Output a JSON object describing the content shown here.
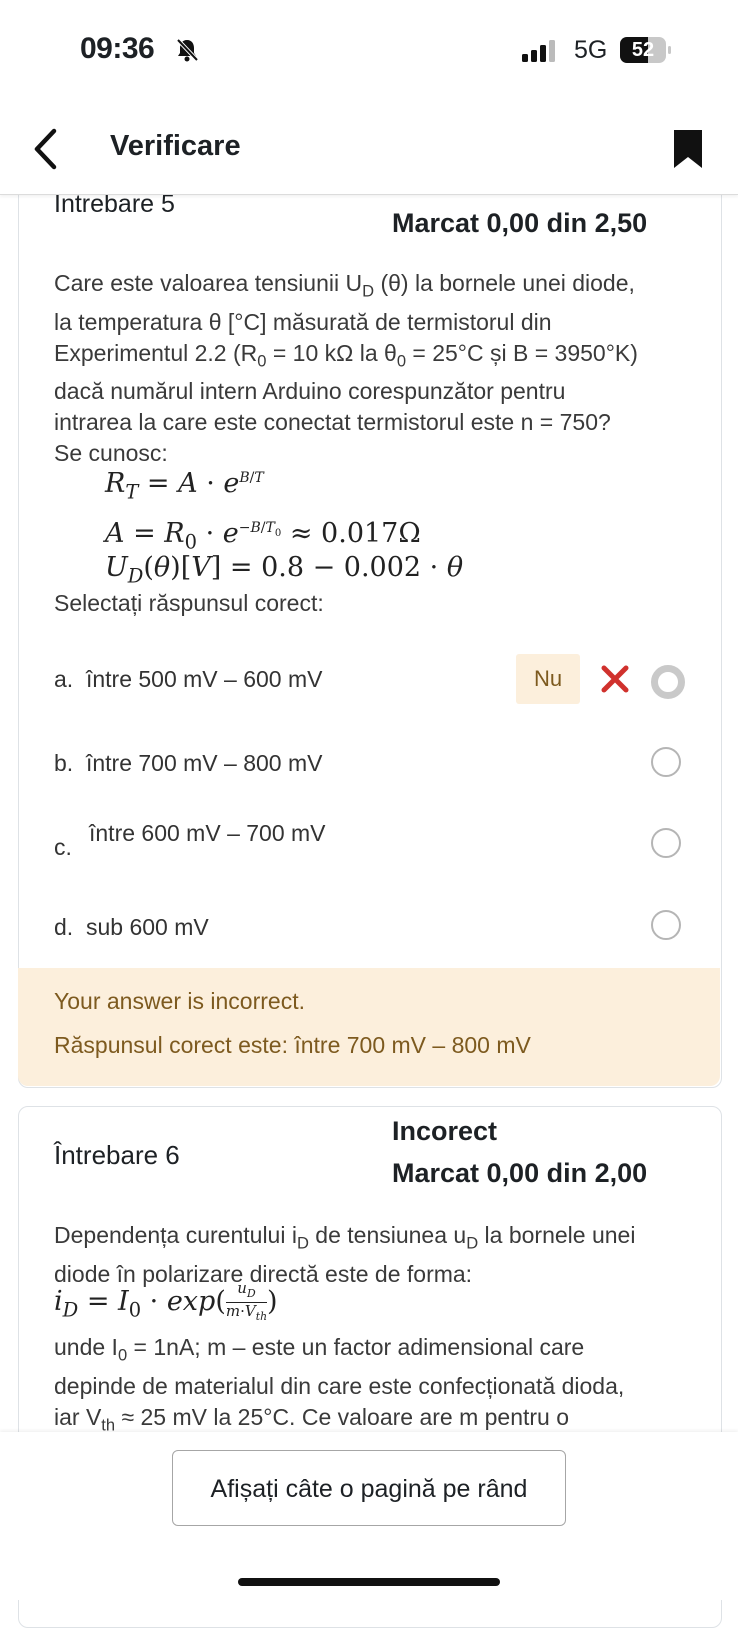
{
  "status_bar": {
    "time": "09:36",
    "network": "5G",
    "battery": "52"
  },
  "app_bar": {
    "title": "Verificare"
  },
  "question5": {
    "title": "Intrebare 5",
    "marks": "Marcat 0,00 din 2,50",
    "text_line1": "Care este valoarea tensiunii U",
    "text_line1_sub": "D",
    "text_line1_rest": " (θ) la bornele unei diode,",
    "text_line2": "la temperatura θ [°C] măsurată de termistorul din",
    "text_line3": "Experimentul 2.2 (R",
    "text_line3_sub": "0",
    "text_line3_mid": " = 10 kΩ la θ",
    "text_line3_sub2": "0",
    "text_line3_rest": " = 25°C și B = 3950°K)",
    "text_line4": "dacă numărul intern Arduino corespunzător pentru",
    "text_line5": "intrarea la care este conectat termistorul este n = 750?",
    "text_line6": "Se cunosc:",
    "eq1": "R_T = A · e^(B/T)",
    "eq2": "A = R_0 · e^(−B/T_0) ≈ 0.017Ω",
    "eq3": "U_D(θ)[V] = 0.8 − 0.002 · θ",
    "select_prompt": "Selectați răspunsul corect:",
    "options": [
      {
        "letter": "a.",
        "text": "între  500 mV – 600 mV"
      },
      {
        "letter": "b.",
        "text": "între 700 mV – 800 mV"
      },
      {
        "letter": "c.",
        "text": "între 600 mV – 700 mV"
      },
      {
        "letter": "d.",
        "text": "sub 600 mV"
      }
    ],
    "badge": "Nu",
    "feedback_incorrect": "Your answer is incorrect.",
    "feedback_correct": "Răspunsul corect este: între 700 mV – 800 mV"
  },
  "question6": {
    "title": "Întrebare 6",
    "state": "Incorect",
    "marks": "Marcat 0,00 din 2,00",
    "text1_a": "Dependența curentului i",
    "text1_sub1": "D",
    "text1_b": " de tensiunea u",
    "text1_sub2": "D",
    "text1_c": " la bornele unei",
    "text1_line2": "diode în polarizare directă este de forma:",
    "eq": "i_D = I_0 · exp(u_D / (m·V_th))",
    "text2_a": "unde I",
    "text2_sub": "0",
    "text2_b": " = 1nA; m – este un factor adimensional care",
    "text2_line2": "depinde de materialul din care este confecționată dioda,",
    "text2_c": "iar V",
    "text2_sub2": "th",
    "text2_d": " ≈ 25 mV la 25°C.  Ce valoare are m pentru o"
  },
  "bottom": {
    "page_button": "Afișați câte o pagină pe rând"
  }
}
